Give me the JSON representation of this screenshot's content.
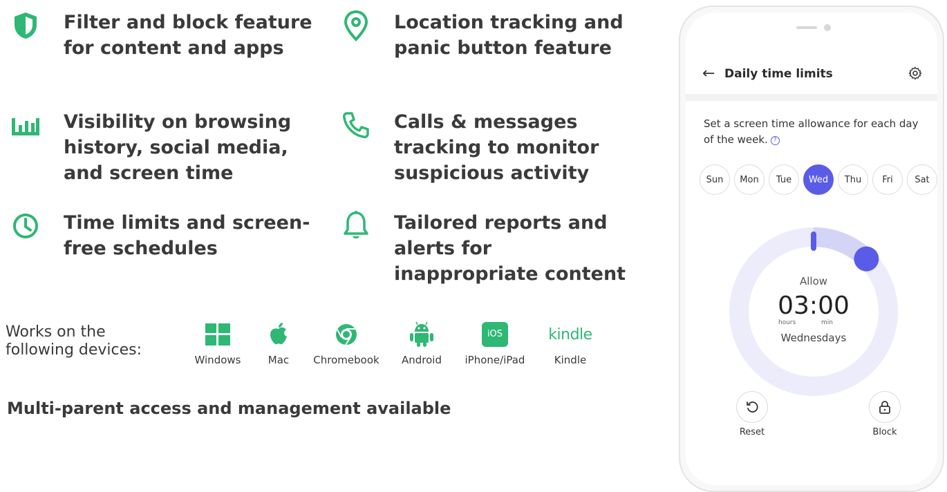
{
  "features": [
    {
      "id": "f1",
      "icon": "shield-icon",
      "text": "Filter and block feature for content and apps"
    },
    {
      "id": "f2",
      "icon": "location-pin-icon",
      "text": "Location tracking and panic button feature"
    },
    {
      "id": "f3",
      "icon": "bar-chart-icon",
      "text": "Visibility on browsing history, social media, and screen time"
    },
    {
      "id": "f4",
      "icon": "phone-icon",
      "text": "Calls & messages tracking to monitor suspicious activity"
    },
    {
      "id": "f5",
      "icon": "clock-icon",
      "text": "Time limits and screen-free schedules"
    },
    {
      "id": "f6",
      "icon": "bell-icon",
      "text": "Tailored reports and alerts for inappropriate content"
    }
  ],
  "works_on": "Works on the following devices:",
  "devices": [
    {
      "label": "Windows",
      "icon": "windows-icon"
    },
    {
      "label": "Mac",
      "icon": "apple-icon"
    },
    {
      "label": "Chromebook",
      "icon": "chrome-icon"
    },
    {
      "label": "Android",
      "icon": "android-icon"
    },
    {
      "label": "iPhone/iPad",
      "icon": "ios-icon",
      "badge": "iOS"
    },
    {
      "label": "Kindle",
      "icon": "kindle-icon",
      "badge": "kindle"
    }
  ],
  "multi_parent": "Multi-parent access and management available",
  "colors": {
    "accent_green": "#2fb774",
    "accent_purple": "#5a5ce8",
    "dial_track": "#ececfb"
  },
  "phone": {
    "title": "Daily time limits",
    "description": "Set a screen time allowance for each day of the week.",
    "days": [
      "Sun",
      "Mon",
      "Tue",
      "Wed",
      "Thu",
      "Fri",
      "Sat"
    ],
    "selected_day": "Wed",
    "allow_label": "Allow",
    "time": "03:00",
    "hours_label": "hours",
    "min_label": "min",
    "day_name": "Wednesdays",
    "allowance_fraction": 0.125,
    "reset_label": "Reset",
    "block_label": "Block"
  }
}
